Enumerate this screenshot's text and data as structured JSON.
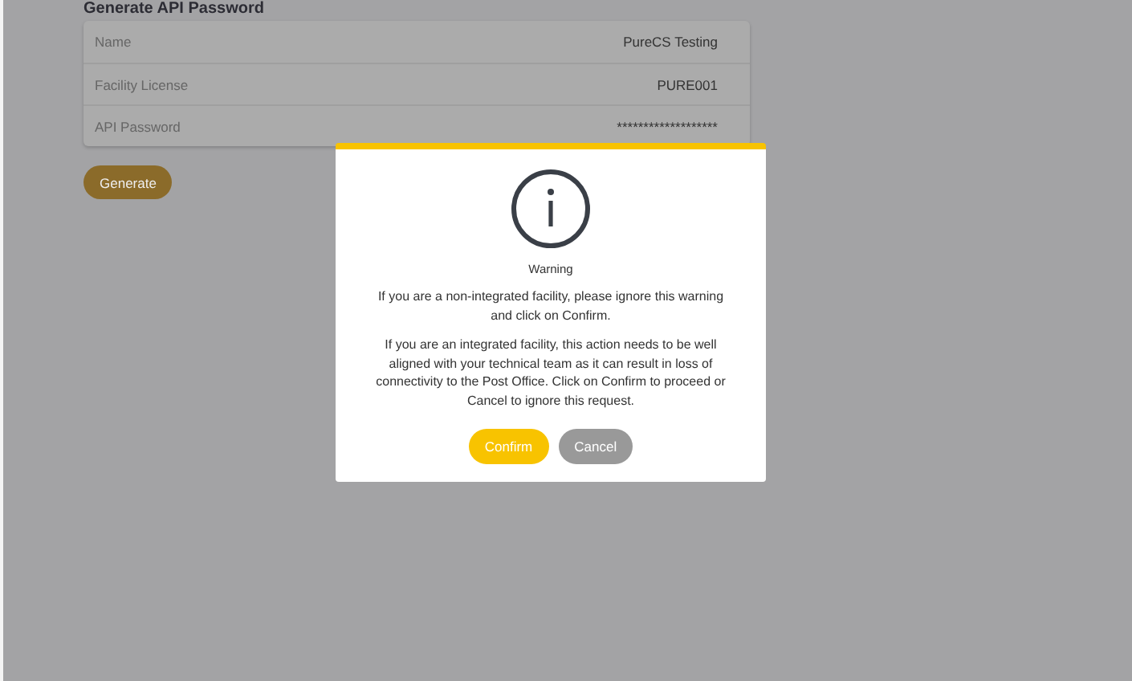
{
  "page": {
    "title": "Generate API Password",
    "fields": [
      {
        "label": "Name",
        "value": "PureCS Testing"
      },
      {
        "label": "Facility License",
        "value": "PURE001"
      },
      {
        "label": "API Password",
        "value": "*******************"
      }
    ],
    "button": "Generate"
  },
  "dialog": {
    "title": "Warning",
    "paragraphs": [
      "If you are a non-integrated facility, please ignore this warning and click on Confirm.",
      "If you are an integrated facility, this action needs to be well aligned with your technical team as it can result in loss of connectivity to the Post Office. Click on Confirm to proceed or Cancel to ignore this request."
    ],
    "buttons": [
      {
        "label": "Confirm",
        "kind": "primary"
      },
      {
        "label": "Cancel",
        "kind": "secondary"
      }
    ]
  }
}
